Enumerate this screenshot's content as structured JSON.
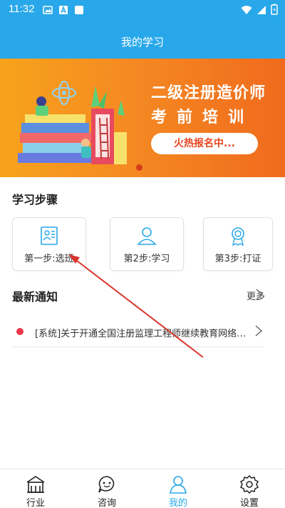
{
  "status_bar": {
    "time": "11:32"
  },
  "header": {
    "title": "我的学习"
  },
  "banner": {
    "title": "二级注册造价师",
    "subtitle": "考前培训",
    "button_label": "火热报名中..."
  },
  "steps_section": {
    "title": "学习步骤",
    "steps": [
      {
        "label": "第一步:选班",
        "icon": "clipboard-icon"
      },
      {
        "label": "第2步:学习",
        "icon": "user-icon"
      },
      {
        "label": "第3步:打证",
        "icon": "badge-icon"
      }
    ]
  },
  "notices_section": {
    "title": "最新通知",
    "more_label": "更多",
    "items": [
      {
        "text": "[系统]关于开通全国注册监理工程师继续教育网络学习的通知"
      }
    ]
  },
  "tab_bar": {
    "items": [
      {
        "label": "行业",
        "icon": "building-icon",
        "active": false
      },
      {
        "label": "咨询",
        "icon": "chat-icon",
        "active": false
      },
      {
        "label": "我的",
        "icon": "person-icon",
        "active": true
      },
      {
        "label": "设置",
        "icon": "gear-icon",
        "active": false
      }
    ]
  },
  "colors": {
    "primary": "#28a8ea",
    "banner_orange": "#f58a22",
    "notice_dot": "#e8384a",
    "annotation_arrow": "#d9342b"
  }
}
